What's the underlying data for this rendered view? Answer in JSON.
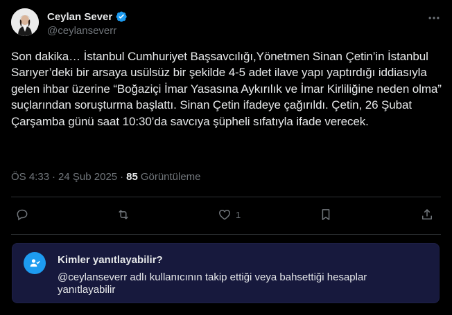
{
  "author": {
    "display_name": "Ceylan Sever",
    "handle": "@ceylanseverr",
    "verified": true
  },
  "tweet": {
    "text": "Son dakika… İstanbul Cumhuriyet Başsavcılığı,Yönetmen Sinan Çetin’in İstanbul Sarıyer’deki bir arsaya usülsüz bir şekilde 4-5 adet ilave yapı yaptırdığı iddiasıyla gelen ihbar üzerine “Boğaziçi İmar Yasasına Aykırılık ve İmar Kirliliğine neden olma” suçlarından soruşturma başlattı. Sinan Çetin ifadeye çağırıldı. Çetin, 26 Şubat Çarşamba günü saat 10:30’da savcıya şüpheli sıfatıyla ifade verecek.",
    "time": "ÖS 4:33",
    "separator": "·",
    "date": "24 Şub 2025",
    "views_count": "85",
    "views_label": "Görüntüleme"
  },
  "actions": {
    "reply_icon": "reply-icon",
    "retweet_icon": "retweet-icon",
    "like_icon": "like-icon",
    "like_count": "1",
    "bookmark_icon": "bookmark-icon",
    "share_icon": "share-icon"
  },
  "reply_restriction": {
    "title": "Kimler yanıtlayabilir?",
    "description": "@ceylanseverr adlı kullanıcının takip ettiği veya bahsettiği hesaplar yanıtlayabilir",
    "icon": "user-check-icon"
  },
  "colors": {
    "background": "#000000",
    "text": "#e7e9ea",
    "muted": "#71767b",
    "accent": "#1d9bf0",
    "card": "#17193d"
  }
}
